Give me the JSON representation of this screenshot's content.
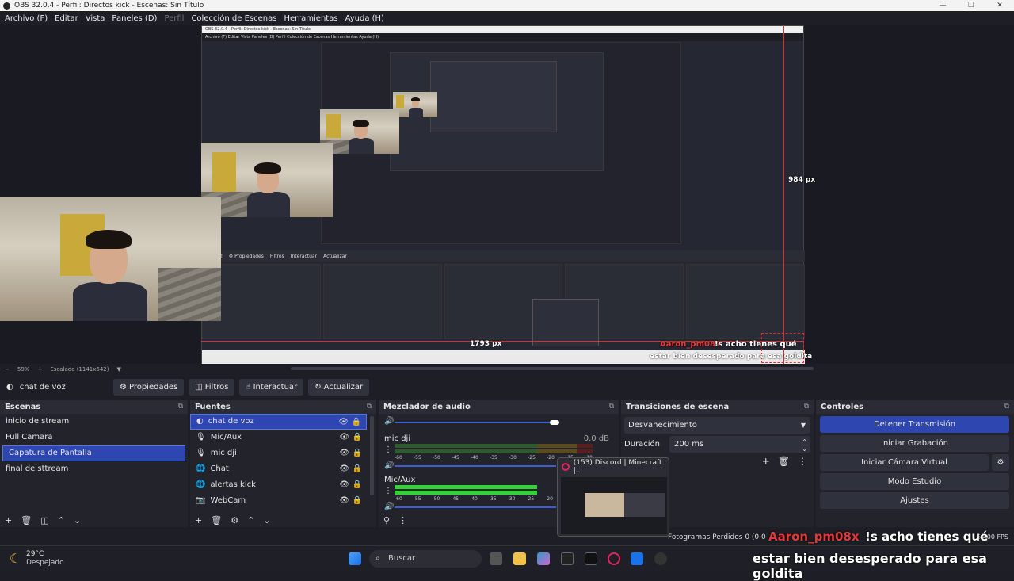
{
  "window": {
    "title": "OBS 32.0.4 - Perfil: Directos kick - Escenas: Sin Título",
    "controls": [
      "—",
      "❐",
      "✕"
    ]
  },
  "menu": {
    "items": [
      "Archivo (F)",
      "Editar",
      "Vista",
      "Paneles (D)",
      "Perfil",
      "Colección de Escenas",
      "Herramientas",
      "Ayuda (H)"
    ],
    "disabled_index": 4
  },
  "preview": {
    "measure_h": "1793 px",
    "measure_v": "984 px",
    "overlay_line1_user": "Aaron_pm08x",
    "overlay_line1_text": "!s acho tienes qué",
    "overlay_line2": "estar bien desesperado para esa goldita"
  },
  "zoom": {
    "percent": "59%",
    "scaled": "Escalado (1141x642)"
  },
  "source_toolbar": {
    "current_source": "chat de voz",
    "properties": "Propiedades",
    "filters": "Filtros",
    "interact": "Interactuar",
    "refresh": "Actualizar"
  },
  "scenes": {
    "title": "Escenas",
    "items": [
      "inicio de stream",
      "Full Camara",
      "Capatura de Pantalla",
      "final de sttream"
    ],
    "selected_index": 2
  },
  "sources": {
    "title": "Fuentes",
    "items": [
      {
        "icon": "audio-capture-icon",
        "label": "chat de voz"
      },
      {
        "icon": "microphone-icon",
        "label": "Mic/Aux"
      },
      {
        "icon": "microphone-icon",
        "label": "mic dji"
      },
      {
        "icon": "browser-icon",
        "label": "Chat"
      },
      {
        "icon": "browser-icon",
        "label": "alertas kick"
      },
      {
        "icon": "camera-icon",
        "label": "WebCam"
      }
    ],
    "selected_index": 0
  },
  "mixer": {
    "title": "Mezclador de audio",
    "channels": [
      {
        "name": "",
        "db": ""
      },
      {
        "name": "mic dji",
        "db": "0.0 dB"
      },
      {
        "name": "Mic/Aux",
        "db": ""
      }
    ],
    "scale": [
      "-60",
      "-55",
      "-50",
      "-45",
      "-40",
      "-35",
      "-30",
      "-25",
      "-20",
      "-15",
      "-10",
      "-5",
      "0"
    ]
  },
  "transitions": {
    "title": "Transiciones de escena",
    "selected": "Desvanecimiento",
    "duration_label": "Duración",
    "duration_value": "200 ms"
  },
  "controls": {
    "title": "Controles",
    "stop_stream": "Detener Transmisión",
    "start_recording": "Iniciar Grabación",
    "start_virtual_cam": "Iniciar Cámara Virtual",
    "studio_mode": "Modo Estudio",
    "settings": "Ajustes"
  },
  "floating_window": {
    "title": "(153) Discord | Minecraft |..."
  },
  "status_bar": {
    "dropped": "Fotogramas Perdidos 0 (0.0",
    "fps": "60.00 FPS"
  },
  "taskbar": {
    "weather_temp": "29°C",
    "weather_desc": "Despejado",
    "search": "Buscar"
  },
  "colors": {
    "accent": "#2d46b0",
    "red_guide": "#ff2020",
    "meter_green": "#35d13a",
    "meter_yellow": "#c9c02e",
    "meter_red": "#c83232"
  }
}
